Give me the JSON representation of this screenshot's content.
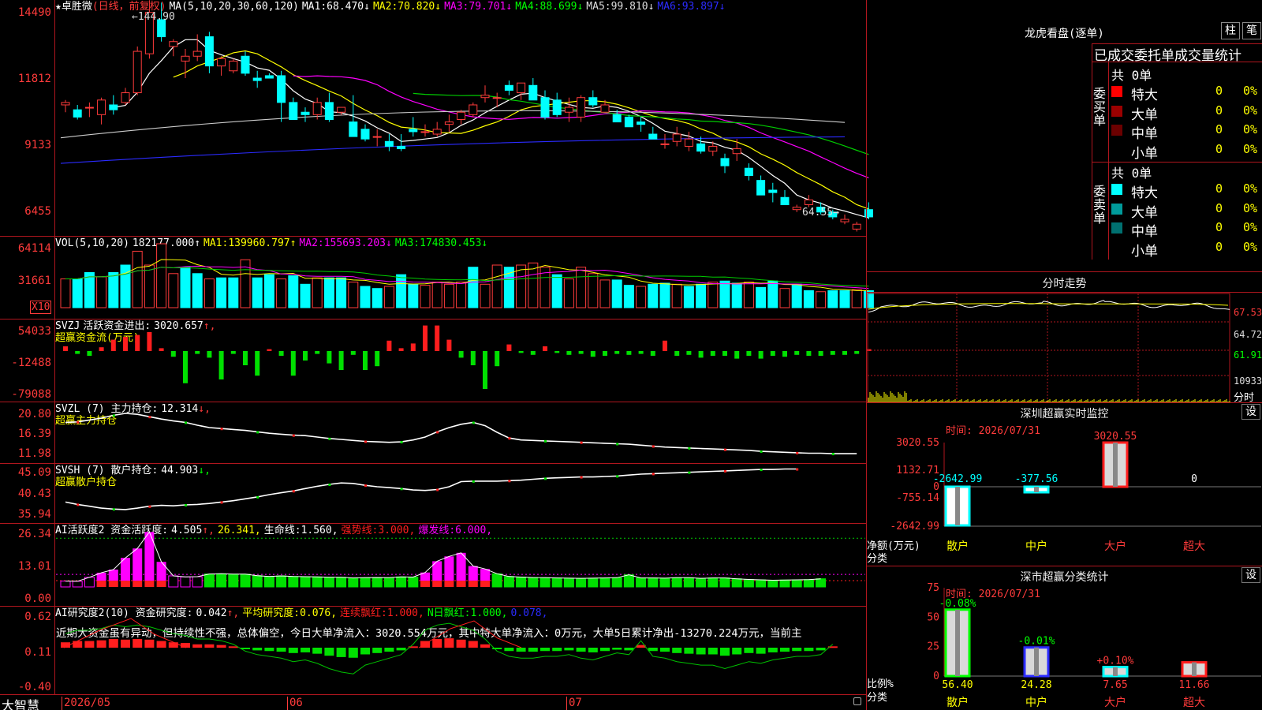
{
  "main_chart": {
    "stock_name": "★卓胜微",
    "mode": "(日线，前复权)",
    "ma_label": "MA(5,10,20,30,60,120)",
    "mas": [
      {
        "label": "MA1:",
        "value": "68.470",
        "arrow": "↓",
        "color": "#ffffff"
      },
      {
        "label": "MA2:",
        "value": "70.820",
        "arrow": "↓",
        "color": "#ffff00"
      },
      {
        "label": "MA3:",
        "value": "79.701",
        "arrow": "↓",
        "color": "#ff00ff"
      },
      {
        "label": "MA4:",
        "value": "88.699",
        "arrow": "↓",
        "color": "#00ff00"
      },
      {
        "label": "MA5:",
        "value": "99.810",
        "arrow": "↓",
        "color": "#dddddd"
      },
      {
        "label": "MA6:",
        "value": "93.897",
        "arrow": "↓",
        "color": "#2b2bff"
      }
    ],
    "y_ticks": [
      "14490",
      "11812",
      "9133",
      "6455"
    ],
    "high_label": "144.90",
    "low_label": "64.55",
    "candles": [
      [
        107,
        109,
        104,
        108
      ],
      [
        105,
        107,
        101,
        102
      ],
      [
        106,
        108,
        102,
        106
      ],
      [
        103,
        110,
        99,
        109
      ],
      [
        107,
        111,
        103,
        105
      ],
      [
        108,
        114,
        107,
        112
      ],
      [
        112,
        131,
        111,
        129
      ],
      [
        128,
        150,
        126,
        145
      ],
      [
        142,
        149,
        133,
        135
      ],
      [
        131,
        134,
        127,
        133
      ],
      [
        125,
        130,
        118,
        127
      ],
      [
        127,
        136,
        125,
        129
      ],
      [
        135,
        137,
        120,
        123
      ],
      [
        123,
        127,
        119,
        126
      ],
      [
        121,
        126,
        120,
        125
      ],
      [
        127,
        129,
        119,
        120
      ],
      [
        118,
        121,
        114,
        117
      ],
      [
        119,
        120,
        118,
        118
      ],
      [
        119,
        121,
        100,
        108
      ],
      [
        108,
        110,
        101,
        101
      ],
      [
        104,
        106,
        100,
        103
      ],
      [
        103,
        110,
        101,
        108
      ],
      [
        108,
        112,
        100,
        101
      ],
      [
        104,
        106,
        103,
        106
      ],
      [
        100,
        111,
        96,
        94
      ],
      [
        97,
        99,
        92,
        93
      ],
      [
        94,
        97,
        90,
        94
      ],
      [
        92,
        95,
        88,
        90
      ],
      [
        90,
        95,
        88,
        89
      ],
      [
        97,
        102,
        94,
        96
      ],
      [
        96,
        99,
        94,
        96
      ],
      [
        95,
        100,
        94,
        97
      ],
      [
        99,
        103,
        96,
        100
      ],
      [
        101,
        105,
        99,
        104
      ],
      [
        103,
        108,
        102,
        107
      ],
      [
        110,
        115,
        108,
        111
      ],
      [
        110,
        112,
        106,
        110
      ],
      [
        115,
        117,
        111,
        113
      ],
      [
        112,
        116,
        109,
        116
      ],
      [
        115,
        118,
        110,
        109
      ],
      [
        110,
        113,
        101,
        102
      ],
      [
        109,
        112,
        102,
        103
      ],
      [
        104,
        110,
        100,
        106
      ],
      [
        102,
        111,
        100,
        110
      ],
      [
        110,
        113,
        106,
        107
      ],
      [
        104,
        109,
        104,
        107
      ],
      [
        103,
        105,
        102,
        100
      ],
      [
        102,
        103,
        98,
        98
      ],
      [
        100,
        102,
        96,
        99
      ],
      [
        95,
        98,
        93,
        93
      ],
      [
        91,
        95,
        89,
        91
      ],
      [
        92,
        98,
        90,
        95
      ],
      [
        90,
        96,
        88,
        93
      ],
      [
        91,
        94,
        87,
        88
      ],
      [
        88,
        92,
        86,
        90
      ],
      [
        85,
        87,
        79,
        82
      ],
      [
        87,
        93,
        84,
        89
      ],
      [
        81,
        83,
        76,
        78
      ],
      [
        76,
        78,
        70,
        70
      ],
      [
        72,
        75,
        67,
        71
      ],
      [
        69,
        72,
        67,
        66
      ],
      [
        64,
        66,
        63,
        65
      ],
      [
        66,
        70,
        65,
        68
      ],
      [
        65,
        67,
        62,
        63
      ],
      [
        63,
        64,
        60,
        61
      ],
      [
        59,
        62,
        58,
        60
      ],
      [
        56,
        59,
        55,
        58
      ],
      [
        64,
        67,
        60,
        61
      ]
    ]
  },
  "vol_panel": {
    "title": "VOL(5,10,20)",
    "items": [
      {
        "value": "182177.000",
        "arrow": "↑",
        "color": "#ffffff"
      },
      {
        "label": "MA1:",
        "value": "139960.797",
        "arrow": "↑",
        "color": "#ffff00"
      },
      {
        "label": "MA2:",
        "value": "155693.203",
        "arrow": "↓",
        "color": "#ff00ff"
      },
      {
        "label": "MA3:",
        "value": "174830.453",
        "arrow": "↓",
        "color": "#00ff00"
      }
    ],
    "y_ticks": [
      "64114",
      "31661"
    ],
    "unit": "X10",
    "bars": [
      2.7,
      2.7,
      3.3,
      2.9,
      3.3,
      4.0,
      5.3,
      4.0,
      6.0,
      3.2,
      3.8,
      3.2,
      2.7,
      2.8,
      2.8,
      4.5,
      2.8,
      3.1,
      2.7,
      3.0,
      2.2,
      2.8,
      2.8,
      2.8,
      2.4,
      2.0,
      1.8,
      2.0,
      3.1,
      2.2,
      2.1,
      2.4,
      2.2,
      2.4,
      3.8,
      2.2,
      4.0,
      3.8,
      4.0,
      4.2,
      3.8,
      3.1,
      2.7,
      3.8,
      3.2,
      2.6,
      2.6,
      2.1,
      2.0,
      2.2,
      2.3,
      2.2,
      2.0,
      2.2,
      2.4,
      2.5,
      2.3,
      2.4,
      1.9,
      2.5,
      1.8,
      2.2,
      1.6,
      1.5,
      1.6,
      1.6,
      1.7,
      1.6
    ]
  },
  "svzj_panel": {
    "name": "SVZJ",
    "line1": "活跃资金进出:",
    "value": "3020.657",
    "arrow": "↑,",
    "line2": "超赢资金流(万元)",
    "y_ticks": [
      "54033",
      "-12488",
      "-79088"
    ],
    "bars": [
      5,
      -3,
      -5,
      4,
      12,
      15,
      17,
      20,
      3,
      -6,
      -34,
      -3,
      -7,
      -30,
      -3,
      -15,
      -26,
      2,
      -5,
      -26,
      -10,
      -3,
      -13,
      -20,
      -4,
      -20,
      -16,
      11,
      3,
      8,
      27,
      27,
      12,
      -7,
      -15,
      -40,
      -16,
      7,
      -2,
      -4,
      5,
      -2,
      -4,
      -3,
      -6,
      -5,
      -3,
      -4,
      -3,
      -5,
      11,
      -5,
      -4,
      -7,
      -5,
      -5,
      -8,
      -5,
      -8,
      -5,
      -6,
      -4,
      -5,
      -5,
      -4,
      -4,
      -3,
      2
    ]
  },
  "svzl_panel": {
    "title": "SVZL (7) 主力持仓:",
    "value": "12.314",
    "arrow": "↓,",
    "line2": "超赢主力持仓",
    "y_ticks": [
      "20.80",
      "16.39",
      "11.98"
    ],
    "series": [
      18.9,
      19.0,
      19.4,
      19.8,
      20.4,
      20.8,
      20.6,
      20.1,
      19.6,
      19.2,
      18.9,
      18.3,
      17.8,
      17.6,
      17.4,
      17.2,
      16.9,
      16.6,
      16.4,
      16.2,
      16.1,
      15.8,
      15.5,
      15.3,
      15.1,
      14.9,
      14.8,
      14.7,
      14.8,
      15.2,
      15.8,
      16.9,
      17.8,
      18.5,
      18.9,
      18.2,
      16.8,
      15.6,
      15.2,
      15.1,
      15.0,
      14.9,
      14.8,
      14.7,
      14.6,
      14.5,
      14.4,
      14.3,
      14.1,
      13.9,
      13.7,
      13.6,
      13.5,
      13.4,
      13.3,
      13.2,
      13.1,
      13.0,
      12.8,
      12.7,
      12.6,
      12.5,
      12.4,
      12.4,
      12.3,
      12.3,
      12.3
    ]
  },
  "svsh_panel": {
    "title": "SVSH (7) 散户持仓:",
    "value": "44.903",
    "arrow": "↓,",
    "line2": "超赢散户持仓",
    "y_ticks": [
      "45.09",
      "40.43",
      "35.94"
    ],
    "series": [
      37.9,
      37.4,
      37.0,
      36.6,
      36.4,
      36.3,
      36.6,
      37.0,
      37.2,
      37.1,
      37.3,
      37.4,
      37.6,
      37.9,
      38.2,
      38.6,
      39.0,
      39.5,
      39.9,
      40.3,
      40.8,
      41.3,
      41.7,
      42.0,
      41.9,
      41.5,
      41.2,
      41.0,
      40.8,
      40.5,
      40.4,
      40.6,
      41.2,
      42.3,
      42.4,
      42.4,
      42.4,
      42.5,
      42.6,
      42.8,
      43.0,
      43.1,
      43.2,
      43.3,
      43.3,
      43.4,
      43.5,
      43.7,
      43.9,
      44.0,
      44.1,
      44.2,
      44.3,
      44.4,
      44.5,
      44.6,
      44.7,
      44.8,
      44.9,
      44.9,
      45.0,
      45.0
    ]
  },
  "ai_activity_panel": {
    "title": "AI活跃度2 资金活跃度:",
    "value": "4.505",
    "items": [
      {
        "value": "26.341",
        "color": "#ffff00"
      },
      {
        "label": "生命线:",
        "value": "1.560",
        "color": "#ffffff"
      },
      {
        "label": "强势线:",
        "value": "3.000",
        "color": "#ff1e1e"
      },
      {
        "label": "爆发线:",
        "value": "6.000",
        "color": "#ff00ff"
      }
    ],
    "y_ticks": [
      "26.34",
      "13.01",
      "0.00"
    ],
    "bars": [
      2.8,
      2.7,
      4.6,
      6.8,
      8.3,
      13.9,
      18.4,
      26.3,
      12.0,
      5.3,
      4.8,
      4.9,
      6.2,
      6.3,
      6.1,
      6.1,
      5.4,
      5.0,
      5.3,
      5.0,
      4.9,
      4.8,
      4.6,
      4.6,
      4.3,
      4.4,
      4.5,
      4.4,
      4.8,
      4.7,
      6.9,
      12.3,
      14.6,
      16.3,
      10.0,
      8.6,
      6.3,
      5.0,
      4.7,
      4.5,
      4.4,
      4.3,
      4.2,
      4.1,
      4.2,
      4.3,
      4.4,
      5.8,
      4.3,
      4.3,
      4.2,
      4.4,
      4.4,
      4.1,
      4.3,
      4.3,
      3.9,
      3.6,
      3.4,
      3.2,
      3.3,
      3.4,
      3.5,
      3.9
    ]
  },
  "ai_research_panel": {
    "title": "AI研究度2(10) 资金研究度:",
    "value": "0.042",
    "items": [
      {
        "label": "平均研究度:",
        "value": "0.076",
        "color": "#ffff00"
      },
      {
        "label": "连续飘红:",
        "value": "1.000",
        "color": "#ff1e1e"
      },
      {
        "label": "N日飘红:",
        "value": "1.000",
        "color": "#00ff00"
      },
      {
        "value": "0.078",
        "color": "#2b2bff"
      }
    ],
    "y_ticks": [
      "0.62",
      "0.11",
      "-0.40"
    ],
    "comment": "近期大资金虽有异动，但持续性不强，总体偏空，今日大单净流入：3020.554万元，其中特大单净流入：0万元，大单5日累计净出-13270.224万元，当前主",
    "bars": [
      0.08,
      0.1,
      0.1,
      0.11,
      0.13,
      0.12,
      0.13,
      0.12,
      0.1,
      0.08,
      0.07,
      0.05,
      0.05,
      0.04,
      0.02,
      -0.02,
      -0.04,
      -0.05,
      -0.06,
      -0.08,
      -0.07,
      -0.09,
      -0.12,
      -0.14,
      -0.15,
      -0.1,
      -0.08,
      -0.06,
      -0.04,
      0.02,
      0.1,
      0.13,
      0.14,
      0.12,
      0.1,
      0.05,
      -0.02,
      -0.05,
      -0.06,
      -0.06,
      -0.05,
      -0.05,
      -0.04,
      -0.06,
      -0.07,
      -0.05,
      -0.03,
      -0.04,
      0.04,
      -0.05,
      -0.06,
      -0.08,
      -0.09,
      -0.1,
      -0.1,
      -0.12,
      -0.1,
      -0.08,
      -0.09,
      -0.07,
      -0.06,
      -0.05,
      -0.05,
      -0.04,
      0.02
    ]
  },
  "date_axis": {
    "labels": [
      "2026/05",
      "06",
      "07"
    ]
  },
  "brand": "大智慧",
  "longhu": {
    "title": "龙虎看盘(逐单)",
    "btn_zhu": "柱",
    "btn_bi": "笔",
    "stat_title": "已成交委托单成交量统计",
    "buy": {
      "side": "委买单",
      "total": "共 0单",
      "rows": [
        {
          "name": "特大",
          "qty": "0",
          "pct": "0%",
          "color": "#ff0000"
        },
        {
          "name": "大单",
          "qty": "0",
          "pct": "0%",
          "color": "#9b0000"
        },
        {
          "name": "中单",
          "qty": "0",
          "pct": "0%",
          "color": "#6b0000"
        },
        {
          "name": "小单",
          "qty": "0",
          "pct": "0%",
          "color": "#000000"
        }
      ]
    },
    "sell": {
      "side": "委卖单",
      "total": "共 0单",
      "rows": [
        {
          "name": "特大",
          "qty": "0",
          "pct": "0%",
          "color": "#00ffff"
        },
        {
          "name": "大单",
          "qty": "0",
          "pct": "0%",
          "color": "#009a9a"
        },
        {
          "name": "中单",
          "qty": "0",
          "pct": "0%",
          "color": "#007070"
        },
        {
          "name": "小单",
          "qty": "0",
          "pct": "0%",
          "color": "#000000"
        }
      ]
    }
  },
  "intraday": {
    "title": "分时走势",
    "price_ticks": [
      "67.53",
      "64.72",
      "61.91"
    ],
    "vol_tick": "10933",
    "label": "分时"
  },
  "sz_monitor": {
    "title": "深圳超赢实时监控",
    "setting": "设",
    "time": "时间: 2026/07/31",
    "y_ticks": [
      "3020.55",
      "1132.71",
      "0",
      "-755.14",
      "-2642.99"
    ],
    "y_label": "净额(万元)",
    "x_label": "分类",
    "categories": [
      "散户",
      "中户",
      "大户",
      "超大"
    ],
    "values": [
      -2642.99,
      -377.56,
      3020.55,
      0
    ],
    "value_labels": [
      "-2642.99",
      "-377.56",
      "3020.55",
      "0"
    ]
  },
  "sz_class": {
    "title": "深市超赢分类统计",
    "setting": "设",
    "time": "时间: 2026/07/31",
    "y_ticks": [
      "75",
      "50",
      "25",
      "0"
    ],
    "y_label": "比例%",
    "x_label": "分类",
    "categories": [
      "散户",
      "中户",
      "大户",
      "超大"
    ],
    "values": [
      56.4,
      24.28,
      7.65,
      11.66
    ],
    "change_labels": [
      "-0.08%",
      "-0.01%",
      "+0.10%",
      ""
    ],
    "value_labels": [
      "56.40",
      "24.28",
      "7.65",
      "11.66"
    ]
  }
}
